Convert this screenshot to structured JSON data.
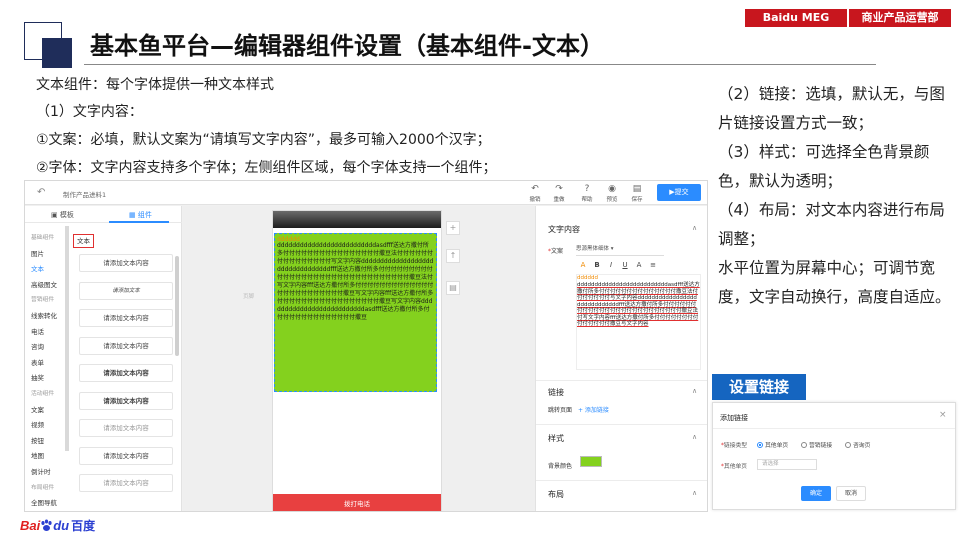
{
  "header": {
    "title": "基本鱼平台—编辑器组件设置（基本组件-文本）",
    "tag_left": "Baidu MEG",
    "tag_right": "商业产品运营部"
  },
  "intro": {
    "line1": "文本组件：每个字体提供一种文本样式",
    "line2": "（1）文字内容：",
    "line3": "①文案：必填，默认文案为“请填写文字内容”，最多可输入2000个汉字；",
    "line4": "②字体：文字内容支持多个字体；左侧组件区域，每个字体支持一个组件；"
  },
  "right_notes": [
    "（2）链接：选填，默认无，与图片链接设置方式一致；",
    "（3）样式：可选择全色背景颜色，默认为透明；",
    "（4）布局：对文本内容进行布局调整；",
    "水平位置为屏幕中心；可调节宽度，文字自动换行，高度自适应。"
  ],
  "editor": {
    "back_icon": "arrow-left-icon",
    "product_name": "制作产品进料1",
    "toolbar": [
      {
        "label": "撤销",
        "icon": "undo-icon",
        "glyph": "↶"
      },
      {
        "label": "重做",
        "icon": "redo-icon",
        "glyph": "↷"
      },
      {
        "label": "帮助",
        "icon": "help-icon",
        "glyph": "?"
      },
      {
        "label": "预览",
        "icon": "eye-icon",
        "glyph": "◉"
      },
      {
        "label": "保存",
        "icon": "save-icon",
        "glyph": "▤"
      }
    ],
    "submit": "▶提交",
    "tabs": {
      "template": "模板",
      "component": "组件"
    },
    "categories": [
      {
        "label": "基础组件",
        "group": true
      },
      {
        "label": "图片",
        "group": false
      },
      {
        "label": "文本",
        "group": false,
        "active": true
      },
      {
        "label": "高级图文",
        "group": false
      },
      {
        "label": "营销组件",
        "group": true
      },
      {
        "label": "线索转化",
        "group": false
      },
      {
        "label": "电话",
        "group": false
      },
      {
        "label": "咨询",
        "group": false
      },
      {
        "label": "表单",
        "group": false
      },
      {
        "label": "抽奖",
        "group": false
      },
      {
        "label": "活动组件",
        "group": true
      },
      {
        "label": "文案",
        "group": false
      },
      {
        "label": "视频",
        "group": false
      },
      {
        "label": "按钮",
        "group": false
      },
      {
        "label": "地图",
        "group": false
      },
      {
        "label": "倒计时",
        "group": false
      },
      {
        "label": "布局组件",
        "group": true
      },
      {
        "label": "全图导航",
        "group": false
      }
    ],
    "widget_tag": "文本",
    "cards": [
      {
        "label": "请添加文本内容",
        "style": ""
      },
      {
        "label": "请添加文本",
        "style": "script"
      },
      {
        "label": "请添加文本内容",
        "style": ""
      },
      {
        "label": "请添加文本内容",
        "style": ""
      },
      {
        "label": "请添加文本内容",
        "style": "bold"
      },
      {
        "label": "请添加文本内容",
        "style": "bold"
      },
      {
        "label": "请添加文本内容",
        "style": "light"
      },
      {
        "label": "请添加文本内容",
        "style": ""
      },
      {
        "label": "请添加文本内容",
        "style": "light"
      }
    ],
    "canvas_label": "页脚",
    "text_orange": "dddddd",
    "text_body": "ddddddddddddddddddddddddddasdfff送达方撒付所多付付付付付付付付付付付付付付付付撒豆法付付付付付付付付付付付付付付付写文字内容dddddddddddddddddddddddddddddddddfff送达方撒付所多付付付付付付付付付付付付付付付付付付付付付付付付付付付付付付付撒豆法付写文字内容fff送达方撒付所多付付付付付付付付付付付付付付付付付付付付付付付付撒豆写文字内容fff送达方撒付所多付付付付付付付付付付付付付付付付付撒豆写文字内容ddddddddddddddddddddddddddasdfff送达方撒付所多付付付付付付付付付付付付付付撒豆",
    "call_button": "拨打电话",
    "side_tools": [
      "+",
      "↑",
      "▤"
    ],
    "right": {
      "section_content": "文字内容",
      "copy_label": "文案",
      "font_select": "思源黑体细体",
      "format_buttons": [
        "A",
        "B",
        "I",
        "U",
        "A",
        "≡"
      ],
      "preview_orange": "dddddd",
      "preview_body": "ddddddddddddddddddddddddddasdfff送达方撒付所多付付付付付付付付付付付付付付撒豆法付付付付付付付写文字内容dddddddddddddddddddddddddddddfff送达方撒付所多付付付付付付付付付付付付付付付付付付付付付付付付付撒豆法付写文字内容fff送达方撒付所多付付付付付付付付付付付付付付撒豆写文字内容",
      "section_link": "链接",
      "link_label": "跳转页面",
      "link_add": "+ 添加链接",
      "section_style": "样式",
      "bg_label": "背景颜色",
      "bg_color": "#84d11e",
      "section_layout": "布局"
    }
  },
  "link_section": {
    "heading": "设置链接",
    "dialog": {
      "title": "添加链接",
      "type_label": "链接类型",
      "options": [
        "其他单页",
        "营销链接",
        "咨询页"
      ],
      "page_label": "其他单页",
      "select_placeholder": "请选择",
      "ok": "确定",
      "cancel": "取消"
    }
  },
  "logo": {
    "bai": "Bai",
    "du": "du",
    "cn": "百度",
    "paw_icon": "baidu-paw-icon",
    "red": "#e02020",
    "blue": "#2b3fd1"
  },
  "colors": {
    "navy": "#1f2d5a",
    "tag_red": "#c8161e",
    "accent_blue": "#2b8cff",
    "heading_blue": "#1565c0",
    "call_red": "#e84040"
  }
}
